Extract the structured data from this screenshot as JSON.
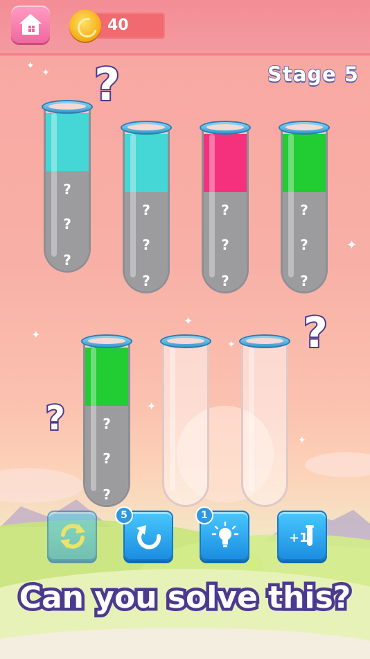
{
  "header": {
    "coins": "40",
    "stage": "Stage 5"
  },
  "tubes": [
    {
      "id": "tube-1",
      "color": "#45d6d6",
      "liquid_label": "cyan",
      "hidden_count": 3
    },
    {
      "id": "tube-2",
      "color": "#45d6d6",
      "liquid_label": "cyan",
      "hidden_count": 3
    },
    {
      "id": "tube-3",
      "color": "#f5317d",
      "liquid_label": "pink",
      "hidden_count": 3
    },
    {
      "id": "tube-4",
      "color": "#22cc33",
      "liquid_label": "green",
      "hidden_count": 3
    },
    {
      "id": "tube-5",
      "color": "#22cc33",
      "liquid_label": "green",
      "hidden_count": 3
    },
    {
      "id": "tube-6",
      "color": "",
      "liquid_label": "empty",
      "hidden_count": 0
    },
    {
      "id": "tube-7",
      "color": "",
      "liquid_label": "empty",
      "hidden_count": 0
    }
  ],
  "hidden_symbol": "?",
  "decor_symbol": "?",
  "toolbar": {
    "restart_icon": "restart-icon",
    "undo_icon": "undo-icon",
    "undo_count": "5",
    "hint_icon": "lightbulb-icon",
    "hint_count": "1",
    "add_tube_icon": "add-tube-icon",
    "add_tube_text": "+1"
  },
  "tagline": "Can you solve this?",
  "colors": {
    "accent_blue": "#1c8de0",
    "home_pink": "#f2679f",
    "coin_gold": "#f7b21c",
    "outline_purple": "#4c3a8f"
  }
}
